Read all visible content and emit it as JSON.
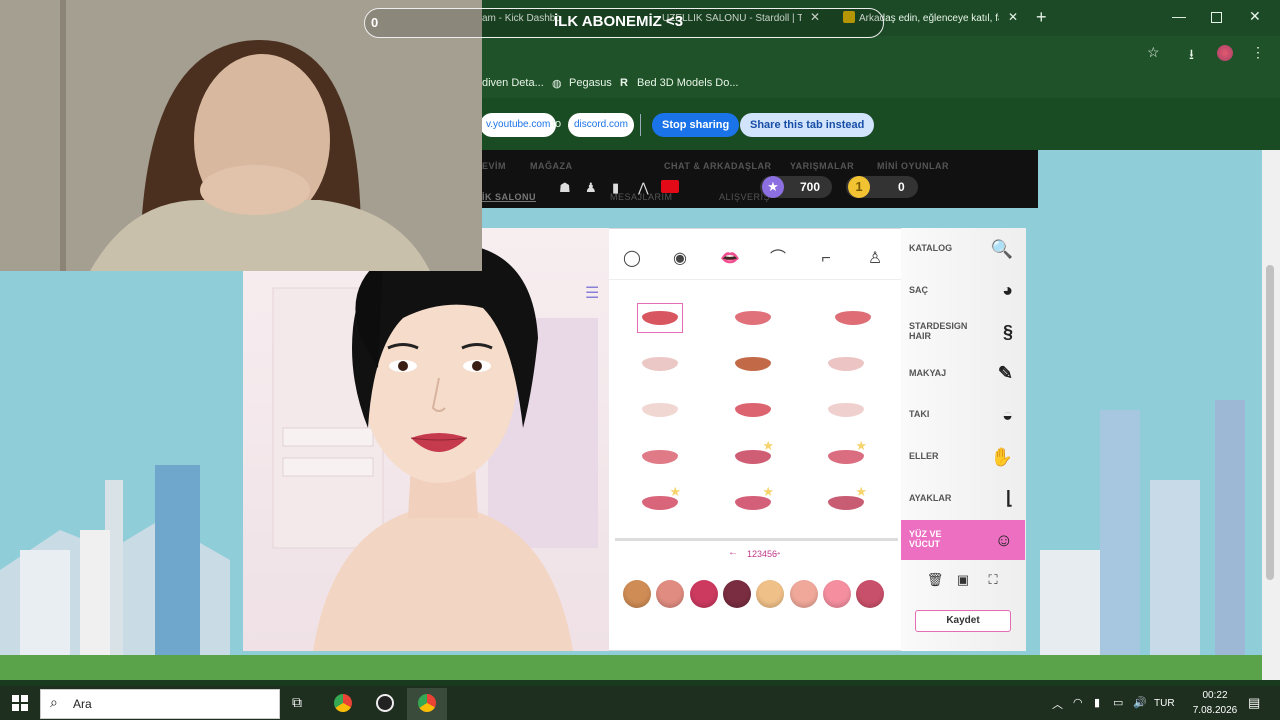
{
  "browser": {
    "tabs": [
      "am - Kick Dashbo",
      "UZELLIK SALONU - Stardoll | T",
      "Arkadaş edin, eğlenceye katıl, fa"
    ],
    "overlay_title": "İLK ABONEMİZ <3",
    "overlay_counter": "0",
    "bookmarks": [
      "diven Deta...",
      "Pegasus",
      "Bed 3D Models Do..."
    ],
    "share": {
      "from": "v.youtube.com",
      "to_label": "to",
      "to": "discord.com",
      "stop": "Stop sharing",
      "share_tab": "Share this tab instead"
    }
  },
  "site": {
    "nav": [
      "EVİM",
      "MAĞAZA",
      "CHAT & ARKADAŞLAR",
      "YARIŞMALAR",
      "MİNİ OYUNLAR"
    ],
    "subnav": [
      "İK SALONU",
      "MESAJLARIM",
      "ALIŞVERİŞ"
    ],
    "stardollars": "700",
    "coins": "0"
  },
  "categories": [
    {
      "label": "KATALOG",
      "icon": "magnifier-icon"
    },
    {
      "label": "SAÇ",
      "icon": "hair-icon"
    },
    {
      "label": "STARDESIGN HAIR",
      "icon": "stardesign-hair-icon"
    },
    {
      "label": "MAKYAJ",
      "icon": "makeup-icon"
    },
    {
      "label": "TAKI",
      "icon": "jewelry-icon"
    },
    {
      "label": "ELLER",
      "icon": "hand-icon"
    },
    {
      "label": "AYAKLAR",
      "icon": "foot-icon"
    },
    {
      "label": "YÜZ VE VÜCUT",
      "icon": "face-body-icon"
    }
  ],
  "feature_tabs": [
    "face-shape-icon",
    "eye-icon",
    "lips-icon",
    "eyebrow-icon",
    "nose-icon",
    "body-icon"
  ],
  "pagination": {
    "prev": "←",
    "pages": "123456",
    "next": "→"
  },
  "save": "Kaydet",
  "lip_colors": [
    "#d7565f",
    "#e0717a",
    "#de6d76",
    "#ebc8c6",
    "#c26a48",
    "#ecc4c4",
    "#f1d7d2",
    "#dc6470",
    "#efd0cf",
    "#e07a86",
    "#cf5d73",
    "#db6d80",
    "#d9657a",
    "#d45f78",
    "#c85c72"
  ],
  "lip_starred": [
    false,
    false,
    false,
    false,
    false,
    false,
    false,
    false,
    false,
    false,
    true,
    true,
    true,
    true,
    true
  ],
  "swatches": [
    "#cf8c55",
    "#e08c80",
    "#cc3a60",
    "#7a2d40",
    "#f0c089",
    "#f0a89a",
    "#f58fa0",
    "#c9506a"
  ],
  "taskbar": {
    "search": "Ara",
    "time": "00:22",
    "date": "7.08.2026",
    "lang": "TUR"
  }
}
